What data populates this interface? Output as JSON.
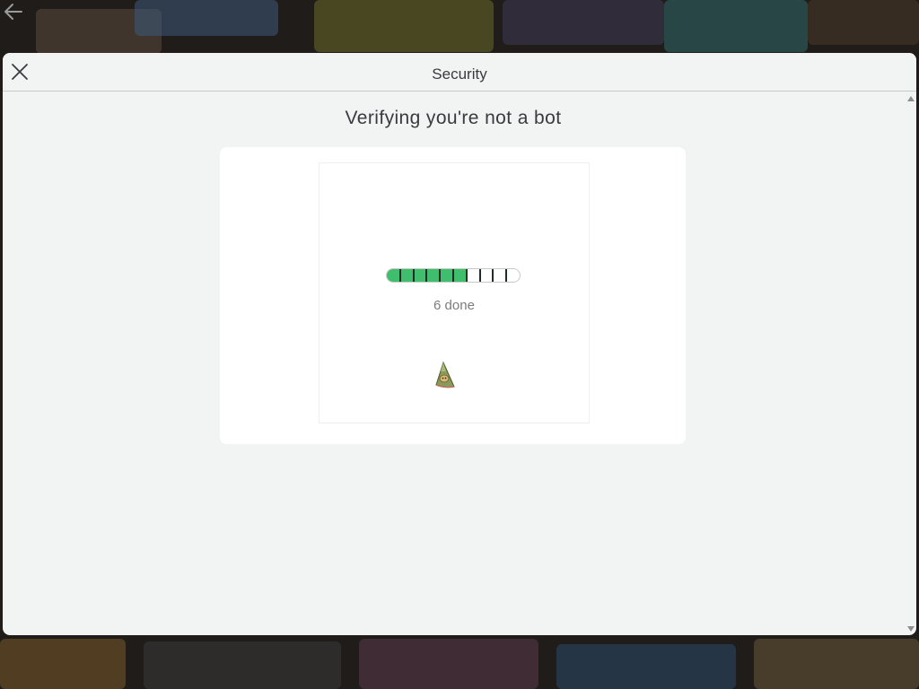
{
  "window": {
    "title": "Security",
    "close_label": "Close"
  },
  "challenge": {
    "heading": "Verifying you're not a bot",
    "progress_text": "6 done",
    "progress": {
      "completed": 6,
      "total": 10,
      "fill_color": "#3fbe6e"
    },
    "puzzle_icon": "cone-puzzle-piece-icon"
  },
  "background": {
    "icon": "back-arrow-icon"
  },
  "colors": {
    "modal_bg": "#f2f3f3",
    "card_bg": "#ffffff",
    "text": "#393b3d",
    "muted_text": "#7b7b7b",
    "accent_green": "#3fbe6e"
  }
}
